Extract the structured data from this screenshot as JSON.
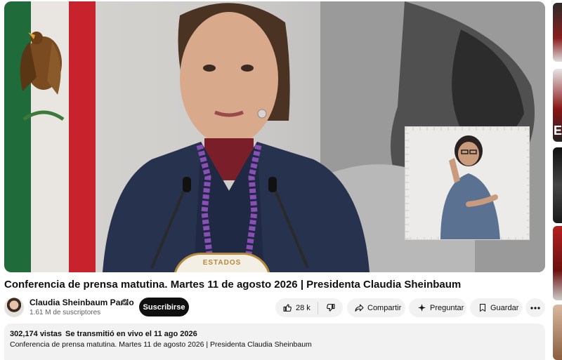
{
  "video": {
    "title": "Conferencia de prensa matutina. Martes 11 de agosto 2026 | Presidenta Claudia Sheinbaum",
    "podium_text": "ESTADOS"
  },
  "channel": {
    "name": "Claudia Sheinbaum Pardo",
    "subscribers": "1.61 M de suscriptores",
    "subscribe_label": "Suscribirse",
    "verified_icon": "verified-check-icon"
  },
  "actions": {
    "like_count": "28 k",
    "like_icon": "thumbs-up-icon",
    "dislike_icon": "thumbs-down-icon",
    "share_label": "Compartir",
    "share_icon": "share-arrow-icon",
    "ask_label": "Preguntar",
    "ask_icon": "sparkle-icon",
    "save_label": "Guardar",
    "save_icon": "bookmark-icon",
    "more_icon": "more-horizontal-icon"
  },
  "description": {
    "views": "302,174 vistas",
    "streamed": "Se transmitió en vivo el 11 ago 2026",
    "text": "Conferencia de prensa matutina. Martes 11 de agosto 2026 | Presidenta Claudia Sheinbaum"
  },
  "sidebar": {
    "thumb_2_overlay": "E"
  },
  "colors": {
    "subscribe_bg": "#0f0f0f",
    "pill_bg": "#f2f2f2",
    "text_primary": "#0f0f0f",
    "text_secondary": "#606060",
    "flag_green": "#1f6b3a",
    "flag_red": "#c8232c",
    "embroidery_purple": "#8a4fb5"
  }
}
